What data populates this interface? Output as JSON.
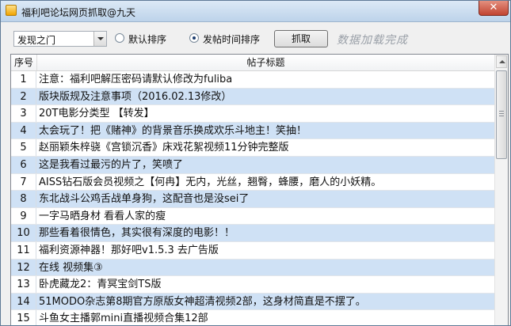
{
  "window": {
    "title": "福利吧论坛网页抓取@九天",
    "close_label": "✕"
  },
  "toolbar": {
    "category": {
      "selected": "发现之门"
    },
    "sort_default": "默认排序",
    "sort_time": "发帖时间排序",
    "sort_selected": "sort_time",
    "grab_label": "抓取",
    "status": "数据加载完成"
  },
  "table": {
    "columns": [
      "序号",
      "帖子标题"
    ],
    "rows": [
      {
        "num": "1",
        "title": "注意：福利吧解压密码请默认修改为fuliba"
      },
      {
        "num": "2",
        "title": "版块版规及注意事项（2016.02.13修改）"
      },
      {
        "num": "3",
        "title": "20T电影分类型 【转发】"
      },
      {
        "num": "4",
        "title": "太会玩了！把《赌神》的背景音乐换成欢乐斗地主！笑抽！"
      },
      {
        "num": "5",
        "title": "赵丽颖朱梓骁《宫锁沉香》床戏花絮视频11分钟完整版"
      },
      {
        "num": "6",
        "title": "这是我看过最污的片了，笑喷了"
      },
      {
        "num": "7",
        "title": "AISS钻石版会员视频之【何冉】无内，光丝，翘臀，蜂腰，磨人的小妖精。"
      },
      {
        "num": "8",
        "title": "东北战斗公鸡舌战单身狗，这配音也是没sei了"
      },
      {
        "num": "9",
        "title": "一字马晒身材 看看人家的瘦"
      },
      {
        "num": "10",
        "title": "那些看着很情色，其实很有深度的电影！！"
      },
      {
        "num": "11",
        "title": "福利资源神器！那好吧v1.5.3 去广告版"
      },
      {
        "num": "12",
        "title": "在线 视频集③"
      },
      {
        "num": "13",
        "title": "卧虎藏龙2：青冥宝剑TS版"
      },
      {
        "num": "14",
        "title": "51MODO杂志第8期官方原版女神超清视频2部，这身材简直是不摆了。"
      },
      {
        "num": "15",
        "title": "斗鱼女主播郭mini直播视频合集12部"
      }
    ]
  },
  "icons": {
    "app": "app-icon",
    "close": "close-icon",
    "dropdown": "chevron-down-icon",
    "scroll_up": "scroll-up-arrow-icon"
  },
  "colors": {
    "row_alt": "#cfe1f5",
    "title_bar": "#c9dcf0",
    "close_button": "#c7503f",
    "status_text": "#9aa0a8"
  }
}
